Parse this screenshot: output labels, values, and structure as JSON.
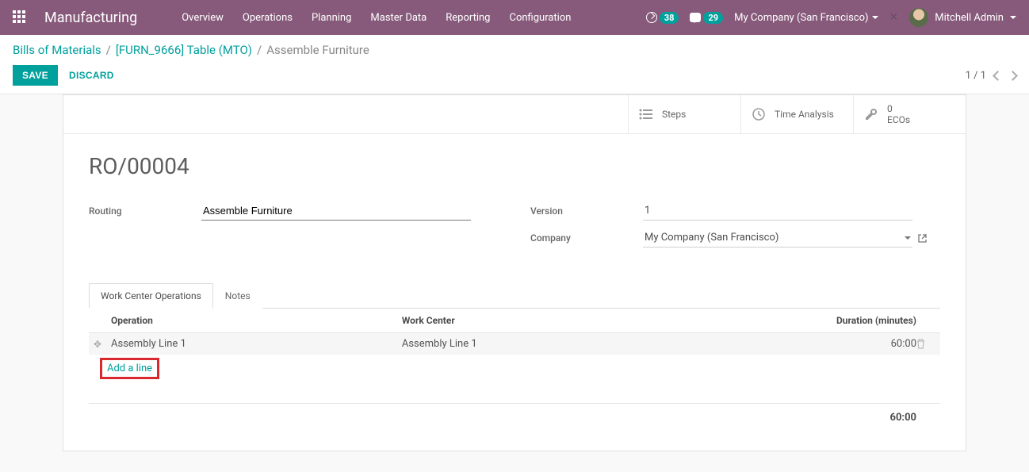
{
  "app": {
    "title": "Manufacturing"
  },
  "nav": {
    "overview": "Overview",
    "operations": "Operations",
    "planning": "Planning",
    "master_data": "Master Data",
    "reporting": "Reporting",
    "configuration": "Configuration"
  },
  "top": {
    "activities_badge": "38",
    "discuss_badge": "29",
    "company": "My Company (San Francisco)",
    "user": "Mitchell Admin"
  },
  "breadcrumb": {
    "root": "Bills of Materials",
    "parent": "[FURN_9666] Table (MTO)",
    "current": "Assemble Furniture"
  },
  "actions": {
    "save": "SAVE",
    "discard": "DISCARD"
  },
  "pager": {
    "text": "1 / 1"
  },
  "stat_buttons": {
    "steps": "Steps",
    "time_analysis": "Time Analysis",
    "ecos_value": "0",
    "ecos_label": "ECOs"
  },
  "record": {
    "name": "RO/00004",
    "routing_label": "Routing",
    "routing_value": "Assemble Furniture",
    "version_label": "Version",
    "version_value": "1",
    "company_label": "Company",
    "company_value": "My Company (San Francisco)"
  },
  "tabs": {
    "work_center_ops": "Work Center Operations",
    "notes": "Notes"
  },
  "grid": {
    "col_operation": "Operation",
    "col_work_center": "Work Center",
    "col_duration": "Duration (minutes)",
    "rows": [
      {
        "operation": "Assembly Line 1",
        "work_center": "Assembly Line 1",
        "duration": "60:00"
      }
    ],
    "add_line": "Add a line",
    "total": "60:00"
  }
}
